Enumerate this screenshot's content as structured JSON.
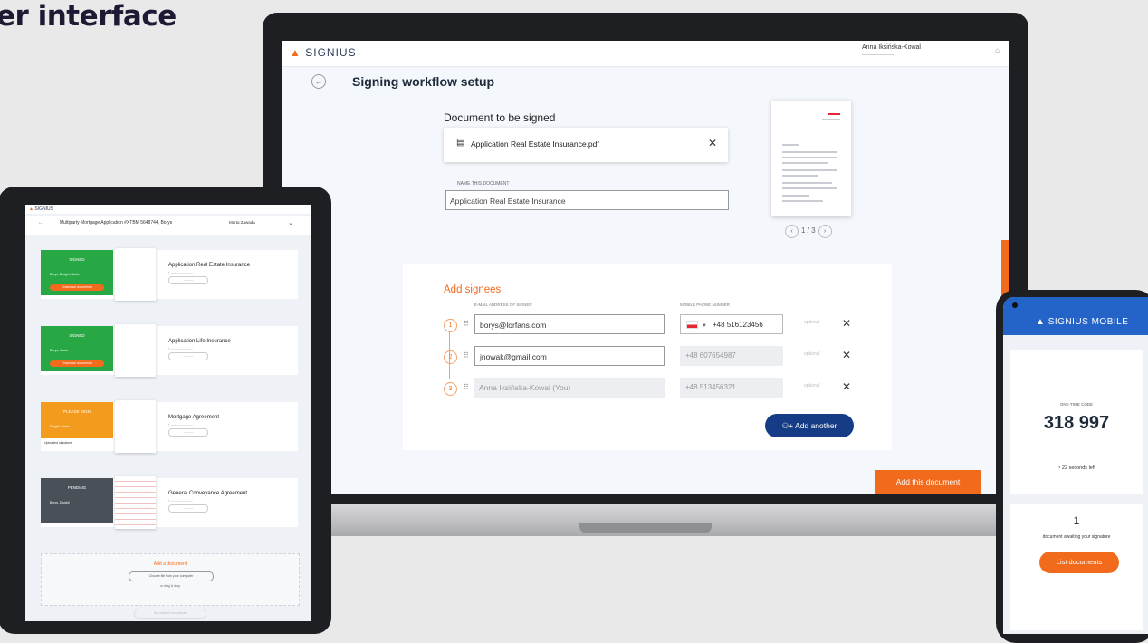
{
  "header": {
    "partial_title": "er interface"
  },
  "laptop": {
    "app_logo": "SIGNIUS",
    "user_name": "Anna Iksińska-Kowal",
    "page_title": "Signing workflow setup",
    "document_label": "Document to be signed",
    "file_name": "Application Real Estate Insurance.pdf",
    "name_label": "NAME THIS DOCUMENT",
    "name_value": "Application Real Estate Insurance",
    "pager": "1 / 3",
    "signees_title": "Add signees",
    "col_email": "E-MAIL ADDRESS OF SIGNER",
    "col_phone": "MOBILE PHONE NUMBER",
    "signees": [
      {
        "num": "1",
        "email": "borys@lorfans.com",
        "phone": "+48 516123456",
        "option": "optional"
      },
      {
        "num": "2",
        "email": "jnowak@gmail.com",
        "phone": "+48 607654987",
        "option": "optional"
      },
      {
        "num": "3",
        "email": "Anna Iksińska-Kowal (You)",
        "phone": "+48 513456321",
        "option": "optional"
      }
    ],
    "add_another": "Add another",
    "add_document": "Add this document"
  },
  "tablet": {
    "app_logo": "SIGNIUS",
    "workflow_title": "Multiparty Mortgage Application #XTBM 5648744, Borys",
    "user_name": "Marta Zawada",
    "items": [
      {
        "status": "SIGNED",
        "name": "Application Real Estate Insurance",
        "color": "#27a844",
        "people": "Borys, Dwight, Marta",
        "button": "Download documents"
      },
      {
        "status": "SIGNED",
        "name": "Application Life Insurance",
        "color": "#27a844",
        "people": "Borys, Marta",
        "button": "Download documents"
      },
      {
        "status": "PLEASE SIGN",
        "name": "Mortgage Agreement",
        "color": "#f29b1d",
        "people": "Dwight, Marta",
        "button": "Upload to sign",
        "note": "Uploaded signature"
      },
      {
        "status": "PENDING",
        "name": "General Conveyance Agreement",
        "color": "#4a5058",
        "people": "Borys, Dwight",
        "button": ""
      }
    ],
    "add_document": "Add a document",
    "choose_file": "Choose file from your computer",
    "drag_drop": "or drag & drop",
    "footer": "Set order of documents"
  },
  "phone": {
    "app_logo": "SIGNIUS MOBILE",
    "code_label": "ONE-TIME CODE",
    "code": "318 997",
    "seconds_left": "22 seconds left",
    "waiting_count": "1",
    "waiting_text": "document awaiting your signature",
    "list_button": "List documents"
  }
}
